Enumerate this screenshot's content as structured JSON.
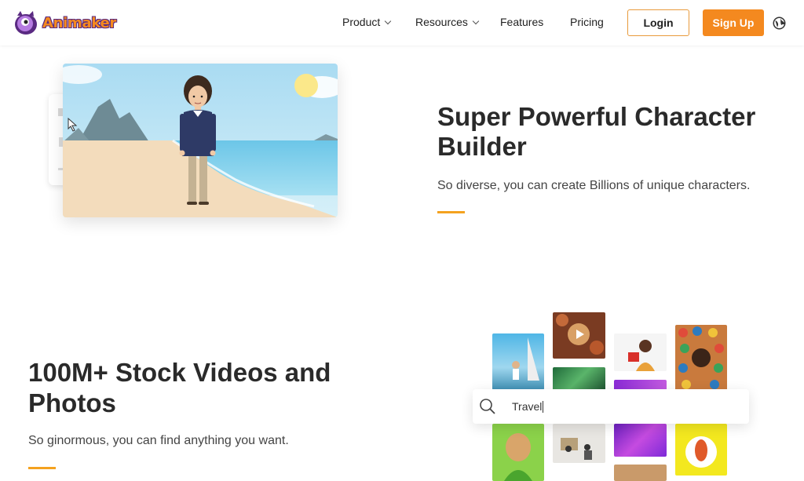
{
  "nav": {
    "logo_text": "Animaker",
    "items": [
      {
        "label": "Product",
        "dropdown": true
      },
      {
        "label": "Resources",
        "dropdown": true
      },
      {
        "label": "Features",
        "dropdown": false
      },
      {
        "label": "Pricing",
        "dropdown": false
      }
    ],
    "login_label": "Login",
    "signup_label": "Sign Up",
    "globe_icon": "globe-icon"
  },
  "section1": {
    "title": "Super Powerful Character Builder",
    "subtitle": "So diverse, you can create Billions of unique characters."
  },
  "section2": {
    "title": "100M+ Stock Videos and Photos",
    "subtitle": "So ginormous, you can find anything you want.",
    "search_value": "Travel"
  },
  "colors": {
    "brand_orange": "#f4891f",
    "accent_bar": "#f4a21f",
    "logo_purple": "#5a2a82"
  }
}
